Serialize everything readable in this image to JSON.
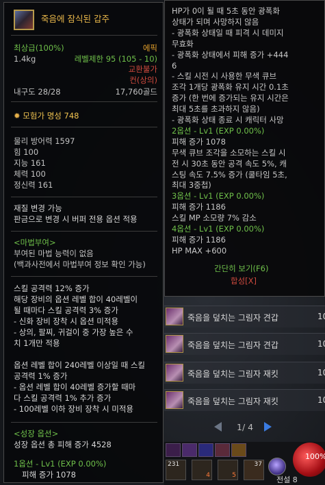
{
  "item": {
    "name": "죽음에 잠식된 갑주",
    "grade": "최상급(100%)",
    "rarity": "에픽",
    "weight": "1.4kg",
    "level_limit": "레벨제한 95 (105 - 10)",
    "trade": "교환불가",
    "seal": "컨(상의)",
    "durability": "내구도 28/28",
    "price": "17,760골드",
    "fame": "모험가 명성 748",
    "stats": [
      "물리 방어력 1597",
      "힘 100",
      "지능 161",
      "체력 100",
      "정신력 161"
    ],
    "material_change": "재질 변경 가능",
    "material_note": "판금으로 변경 시 버퍼 전용 옵션 적용",
    "magic_seal_title": "<마법부여>",
    "magic_seal_lines": [
      "부여된 마법 능력이 없음",
      "(백과사전에서 마법부여 정보 확인 가능)"
    ],
    "option_lines": [
      "스킬 공격력 12% 증가",
      "해당 장비의 옵션 레벨 합이 40레벨이",
      "될 때마다 스킬 공격력 3% 증가",
      "- 신화 장비 장착 시 옵션 미적용",
      "- 상의, 팔찌, 귀걸이 중 가장 높은 수",
      "치 1개만 적용",
      "옵션 레벨 합이 240레벨 이상일 때 스킬",
      "공격력 1% 증가",
      "- 옵션 레벨 합이 40레벨 증가할 때마",
      "다 스킬 공격력 1% 추가 증가",
      "- 100레벨 이하 장비 장착 시 미적용"
    ],
    "growth_title": "<성장 옵션>",
    "growth_total": "성장 옵션 총 피해 증가 4528",
    "growth1": "1옵션 - Lv1 (EXP 0.00%)",
    "growth1_dmg": "피해 증가 1078"
  },
  "detail": {
    "lines": [
      {
        "t": "HP가 0이 될 때 5초 동안 광폭화",
        "c": "w"
      },
      {
        "t": "상태가 되며 사망하지 않음",
        "c": "w"
      },
      {
        "t": "- 광폭화 상태일 때 피격 시 데미지",
        "c": "w"
      },
      {
        "t": "무효화",
        "c": "w"
      },
      {
        "t": "- 광폭화 상태에서 피해 증가 +444",
        "c": "w"
      },
      {
        "t": "6",
        "c": "w"
      },
      {
        "t": "- 스킬 시전 시 사용한 무색 큐브",
        "c": "w"
      },
      {
        "t": "조각 1개당 광폭화 유지 시간 0.1초",
        "c": "w"
      },
      {
        "t": "증가 (한 번에 증가되는 유지 시간은",
        "c": "w"
      },
      {
        "t": "최대 5초를 초과하지 않음)",
        "c": "w"
      },
      {
        "t": "- 광폭화 상태 종료 시 캐릭터 사망",
        "c": "w"
      },
      {
        "t": "2옵션 - Lv1 (EXP 0.00%)",
        "c": "g"
      },
      {
        "t": "피해 증가 1078",
        "c": "w"
      },
      {
        "t": "무색 큐브 조각을 소모하는 스킬 시",
        "c": "w"
      },
      {
        "t": "전 시 30초 동안 공격 속도 5%, 캐",
        "c": "w"
      },
      {
        "t": "스팅 속도 7.5% 증가 (쿨타임 5초,",
        "c": "w"
      },
      {
        "t": "최대 3중첩)",
        "c": "w"
      },
      {
        "t": "3옵션 - Lv1 (EXP 0.00%)",
        "c": "g"
      },
      {
        "t": "피해 증가 1186",
        "c": "w"
      },
      {
        "t": "스킬 MP 소모량 7% 감소",
        "c": "w"
      },
      {
        "t": "4옵션 - Lv1 (EXP 0.00%)",
        "c": "g"
      },
      {
        "t": "피해 증가 1186",
        "c": "w"
      },
      {
        "t": "HP MAX +600",
        "c": "w"
      }
    ],
    "brief_view": "간단히 보기(F6)",
    "synthesis": "합성[X]"
  },
  "list": {
    "rows": [
      {
        "name": "죽음을 덮치는 그림자 견갑",
        "num": "10"
      },
      {
        "name": "죽음을 덮치는 그림자 견갑",
        "num": "10"
      },
      {
        "name": "죽음을 덮치는 그림자 재킷",
        "num": "10"
      },
      {
        "name": "죽음을 덮치는 그림자 재킷",
        "num": "10"
      }
    ],
    "pager": "1/ 4"
  },
  "hud": {
    "slot_counts": [
      "231",
      "4",
      "5",
      "37"
    ],
    "hp": "100%",
    "bag": "전설 8"
  }
}
